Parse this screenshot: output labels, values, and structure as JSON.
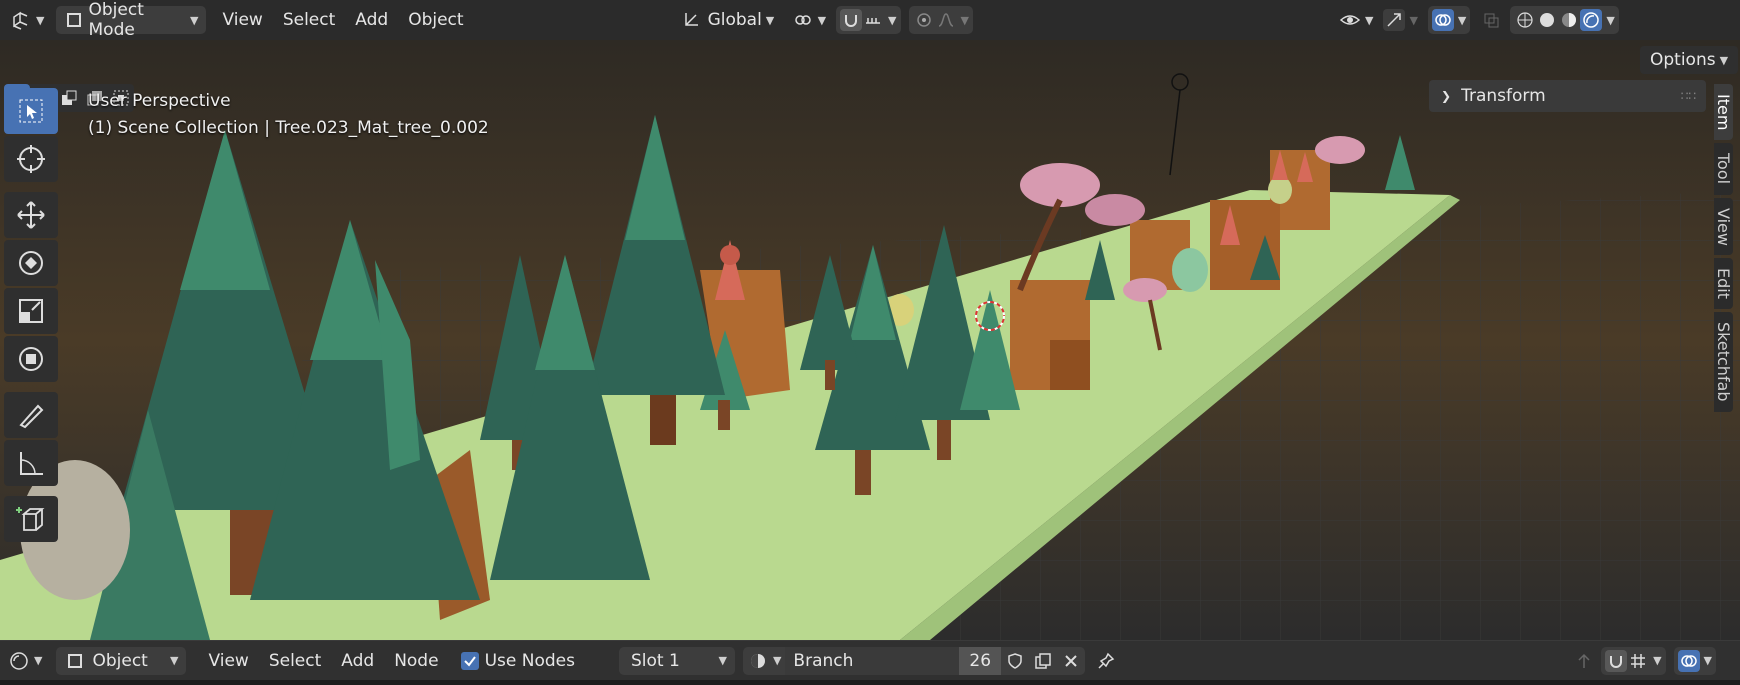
{
  "header": {
    "mode_label": "Object Mode",
    "menus": [
      "View",
      "Select",
      "Add",
      "Object"
    ],
    "orientation_label": "Global"
  },
  "viewport": {
    "perspective_label": "User Perspective",
    "collection_label": "(1) Scene Collection | Tree.023_Mat_tree_0.002",
    "options_label": "Options",
    "transform_label": "Transform",
    "side_tabs": [
      "Item",
      "Tool",
      "View",
      "Edit",
      "Sketchfab"
    ]
  },
  "node_editor": {
    "type_label": "Object",
    "menus": [
      "View",
      "Select",
      "Add",
      "Node"
    ],
    "use_nodes_label": "Use Nodes",
    "slot_label": "Slot 1",
    "material_name": "Branch",
    "user_count": "26"
  },
  "colors": {
    "accent": "#4772b3",
    "ground": "#b9d98f",
    "tree_dark": "#2f6455",
    "tree_light": "#3f8a6c",
    "trunk": "#7a4526",
    "rock": "#b06a30",
    "blossom": "#d79ab0",
    "grid_bg": "#2a2926"
  }
}
